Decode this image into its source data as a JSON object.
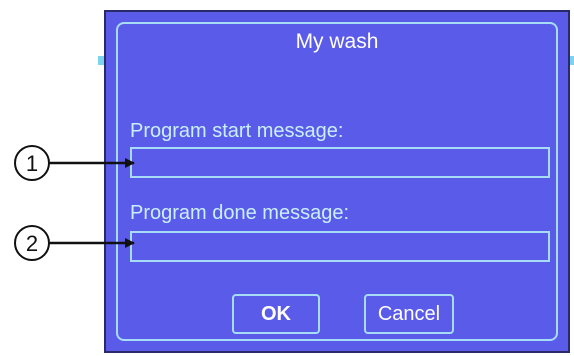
{
  "dialog": {
    "title": "My wash",
    "fields": [
      {
        "label": "Program start message:",
        "value": ""
      },
      {
        "label": "Program done message:",
        "value": ""
      }
    ],
    "buttons": {
      "ok": "OK",
      "cancel": "Cancel"
    }
  },
  "callouts": [
    "1",
    "2"
  ],
  "colors": {
    "dialog_background": "#5b5bea",
    "accent_border": "#a6dcf5",
    "label_text": "#c9f0ff"
  }
}
